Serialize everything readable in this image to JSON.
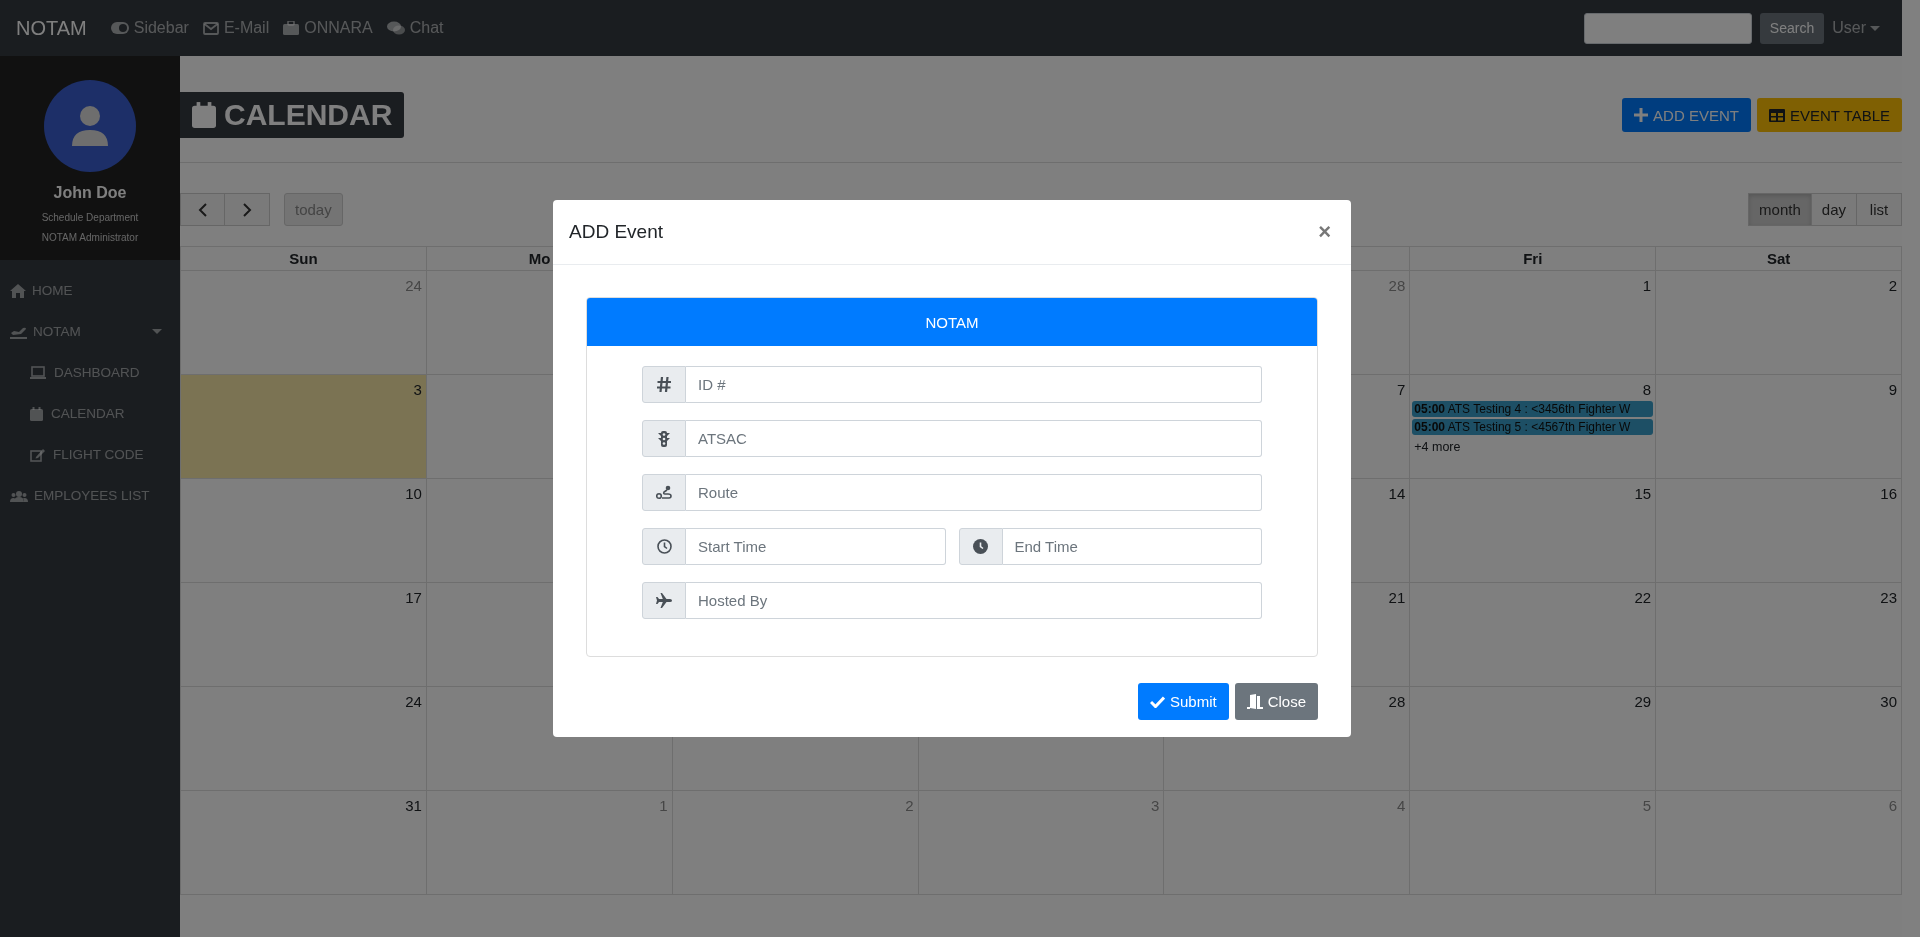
{
  "navbar": {
    "brand": "NOTAM",
    "links": [
      {
        "label": "Sidebar"
      },
      {
        "label": "E-Mail"
      },
      {
        "label": "ONNARA"
      },
      {
        "label": "Chat"
      }
    ],
    "search_button": "Search",
    "user_menu": "User"
  },
  "sidebar": {
    "profile": {
      "name": "John Doe",
      "department": "Schedule Department",
      "role": "NOTAM Administrator"
    },
    "items": [
      {
        "label": "HOME"
      },
      {
        "label": "NOTAM",
        "expanded": true,
        "children": [
          {
            "label": "DASHBOARD"
          },
          {
            "label": "CALENDAR"
          },
          {
            "label": "FLIGHT CODE"
          }
        ]
      },
      {
        "label": "EMPLOYEES LIST"
      }
    ]
  },
  "page": {
    "title": "CALENDAR",
    "buttons": [
      {
        "label": "ADD EVENT",
        "kind": "primary"
      },
      {
        "label": "EVENT TABLE",
        "kind": "warning"
      }
    ]
  },
  "calendar": {
    "today_button": "today",
    "views": [
      {
        "label": "month",
        "selected": true
      },
      {
        "label": "day",
        "selected": false
      },
      {
        "label": "list",
        "selected": false
      }
    ],
    "weekdays": {
      "sun": "Sun",
      "mon": "Mo",
      "fri": "Fri",
      "sat": "Sat"
    },
    "weeks": [
      {
        "sun": {
          "date": "24",
          "other_month": true,
          "today": false
        },
        "thu": {
          "date": "28",
          "other_month": true,
          "today": false
        },
        "fri": {
          "date": "1",
          "other_month": false,
          "today": false
        },
        "sat": {
          "date": "2",
          "other_month": false,
          "today": false
        }
      },
      {
        "sun": {
          "date": "3",
          "other_month": false,
          "today": true
        },
        "thu": {
          "date": "7",
          "other_month": false,
          "today": false
        },
        "fri": {
          "date": "8",
          "other_month": false,
          "today": false,
          "events": [
            {
              "time": "05:00",
              "title": "ATS Testing 4 : <3456th Fighter W"
            },
            {
              "time": "05:00",
              "title": "ATS Testing 5 : <4567th Fighter W"
            }
          ],
          "more": "+4 more"
        },
        "sat": {
          "date": "9",
          "other_month": false,
          "today": false
        }
      },
      {
        "sun": {
          "date": "10",
          "other_month": false,
          "today": false
        },
        "thu": {
          "date": "14",
          "other_month": false,
          "today": false
        },
        "fri": {
          "date": "15",
          "other_month": false,
          "today": false
        },
        "sat": {
          "date": "16",
          "other_month": false,
          "today": false
        }
      },
      {
        "sun": {
          "date": "17",
          "other_month": false,
          "today": false
        },
        "thu": {
          "date": "21",
          "other_month": false,
          "today": false
        },
        "fri": {
          "date": "22",
          "other_month": false,
          "today": false
        },
        "sat": {
          "date": "23",
          "other_month": false,
          "today": false
        }
      },
      {
        "sun": {
          "date": "24",
          "other_month": false,
          "today": false
        },
        "thu": {
          "date": "28",
          "other_month": false,
          "today": false
        },
        "fri": {
          "date": "29",
          "other_month": false,
          "today": false
        },
        "sat": {
          "date": "30",
          "other_month": false,
          "today": false
        }
      },
      {
        "sun": {
          "date": "31",
          "other_month": false,
          "today": false
        },
        "mon": {
          "date": "1",
          "other_month": true,
          "today": false
        },
        "tue": {
          "date": "2",
          "other_month": true,
          "today": false
        },
        "wed": {
          "date": "3",
          "other_month": true,
          "today": false
        },
        "thu": {
          "date": "4",
          "other_month": true,
          "today": false
        },
        "fri": {
          "date": "5",
          "other_month": true,
          "today": false
        },
        "sat": {
          "date": "6",
          "other_month": true,
          "today": false
        }
      }
    ]
  },
  "modal": {
    "title": "ADD Event",
    "close": "×",
    "card_header": "NOTAM",
    "rows": [
      [
        {
          "placeholder": "ID #"
        }
      ],
      [
        {
          "placeholder": "ATSAC"
        }
      ],
      [
        {
          "placeholder": "Route"
        }
      ],
      [
        {
          "placeholder": "Start Time"
        },
        {
          "placeholder": "End Time"
        }
      ],
      [
        {
          "placeholder": "Hosted By"
        }
      ]
    ],
    "buttons": [
      {
        "label": "Submit",
        "kind": "primary"
      },
      {
        "label": "Close",
        "kind": "secondary"
      }
    ]
  }
}
